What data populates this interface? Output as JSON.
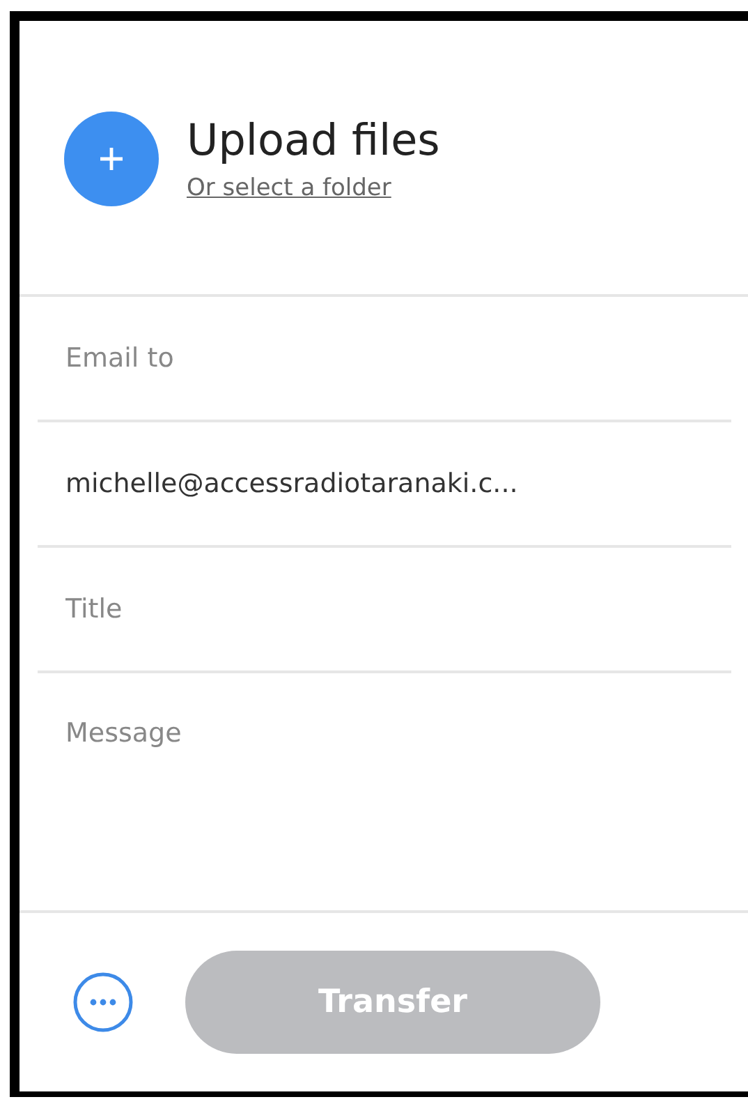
{
  "upload": {
    "title": "Upload files",
    "link": "Or select a folder"
  },
  "email_to": {
    "placeholder": "Email to"
  },
  "recipients": [
    "michelle@accessradiotaranaki.c..."
  ],
  "title_field": {
    "placeholder": "Title"
  },
  "message_field": {
    "placeholder": "Message"
  },
  "transfer_button": {
    "label": "Transfer",
    "disabled": true
  }
}
